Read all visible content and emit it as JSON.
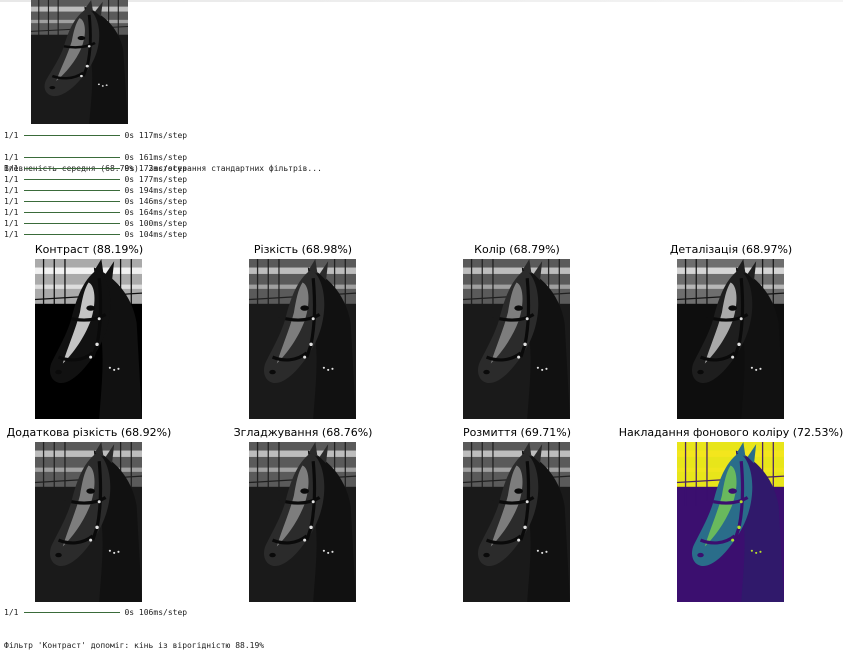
{
  "preview": {
    "image": "horse-image"
  },
  "log_top": [
    {
      "prefix": "1/1",
      "time": "0s",
      "rate": "117ms/step"
    }
  ],
  "message_confidence": "Впевненість середня (68.79%). Застосування стандартних фільтрів...",
  "log_filters": [
    {
      "prefix": "1/1",
      "time": "0s",
      "rate": "161ms/step"
    },
    {
      "prefix": "1/1",
      "time": "0s",
      "rate": "172ms/step"
    },
    {
      "prefix": "1/1",
      "time": "0s",
      "rate": "177ms/step"
    },
    {
      "prefix": "1/1",
      "time": "0s",
      "rate": "194ms/step"
    },
    {
      "prefix": "1/1",
      "time": "0s",
      "rate": "146ms/step"
    },
    {
      "prefix": "1/1",
      "time": "0s",
      "rate": "164ms/step"
    },
    {
      "prefix": "1/1",
      "time": "0s",
      "rate": "100ms/step"
    },
    {
      "prefix": "1/1",
      "time": "0s",
      "rate": "104ms/step"
    }
  ],
  "panels": [
    {
      "title": "Контраст (88.19%)",
      "style": "contrast"
    },
    {
      "title": "Різкість (68.98%)",
      "style": "gray"
    },
    {
      "title": "Колір (68.79%)",
      "style": "gray"
    },
    {
      "title": "Деталізація (68.97%)",
      "style": "detail"
    },
    {
      "title": "Додаткова різкість (68.92%)",
      "style": "gray"
    },
    {
      "title": "Згладжування (68.76%)",
      "style": "gray"
    },
    {
      "title": "Розмиття (69.71%)",
      "style": "gray"
    },
    {
      "title": "Накладання фонового коліру (72.53%)",
      "style": "viridis"
    }
  ],
  "log_bottom": [
    {
      "prefix": "1/1",
      "time": "0s",
      "rate": "106ms/step"
    }
  ],
  "message_result": "Фільтр 'Контраст' допоміг: кінь із вірогідністю 88.19%",
  "colors": {
    "log_bar": "#3a6b3a",
    "viridis_bg": "#e8e51a",
    "viridis_dark": "#3b0f6f"
  }
}
